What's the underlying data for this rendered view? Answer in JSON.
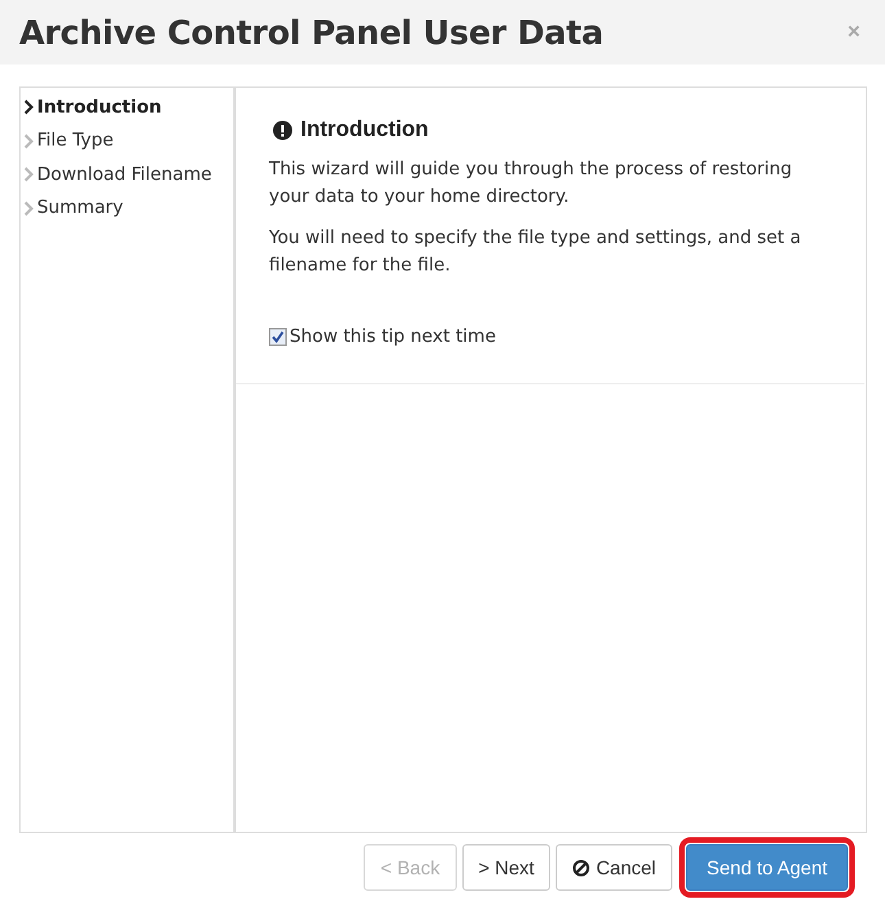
{
  "window": {
    "title": "Archive Control Panel User Data",
    "close": "×"
  },
  "steps": [
    {
      "label": "Introduction",
      "selected": true
    },
    {
      "label": "File Type",
      "selected": false
    },
    {
      "label": "Download Filename",
      "selected": false
    },
    {
      "label": "Summary",
      "selected": false
    }
  ],
  "panel": {
    "heading": "Introduction",
    "paragraphs": [
      "This wizard will guide you through the process of restoring your data to your home directory.",
      "You will need to specify the file type and settings, and set a filename for the file."
    ],
    "tip": {
      "label": "Show this tip next time",
      "checked": true
    }
  },
  "buttons": [
    {
      "kind": "back",
      "label": "< Back",
      "disabled": true,
      "highlighted": false
    },
    {
      "kind": "next",
      "label": "> Next",
      "disabled": false,
      "highlighted": false
    },
    {
      "kind": "cancel",
      "label": "Cancel",
      "disabled": false,
      "highlighted": false
    },
    {
      "kind": "primary",
      "label": "Send to Agent",
      "disabled": false,
      "highlighted": true
    }
  ]
}
